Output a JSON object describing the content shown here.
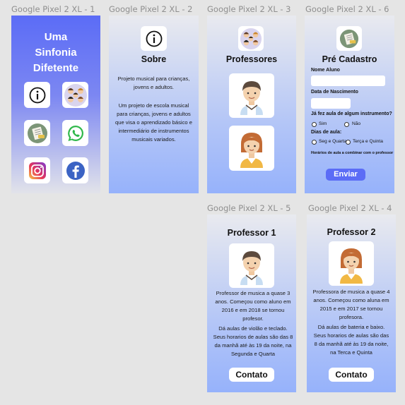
{
  "artboards": {
    "a1": "Google Pixel 2 XL - 1",
    "a2": "Google Pixel 2 XL - 2",
    "a3": "Google Pixel 2 XL - 3",
    "a6": "Google Pixel 2 XL - 6",
    "a5": "Google Pixel 2 XL - 5",
    "a4": "Google Pixel 2 XL - 4"
  },
  "home": {
    "title_line1": "Uma",
    "title_line2": "Sinfonia",
    "title_line3": "Difetente",
    "icons": [
      "info-icon",
      "teachers-group-icon",
      "pre-register-icon",
      "whatsapp-icon",
      "instagram-icon",
      "facebook-icon"
    ]
  },
  "sobre": {
    "title": "Sobre",
    "p1": "Projeto musical para crianças, jovens e adultos.",
    "p2": "Um projeto de escola musical para crianças, jovens e adultos que visa o aprendizado básico e intermediário de instrumentos musicais variados."
  },
  "professores": {
    "title": "Professores"
  },
  "cadastro": {
    "title": "Pré Cadastro",
    "nome_label": "Nome Aluno",
    "nasc_label": "Data de Nascimento",
    "question": "Já fez aula de algum instrumento?",
    "sim": "Sim",
    "nao": "Não",
    "dias_label": "Dias de aula:",
    "dia1": "Seg e Quarta",
    "dia2": "Terça e Quinta",
    "note": "Horários de aula a combinar com o professor",
    "submit": "Enviar"
  },
  "prof1": {
    "title": "Professor 1",
    "p1": "Professor de musica a quase 3 anos. Começou como aluno em 2016 e em 2018 se tornou profesor.",
    "p2": "Dá aulas de violão e teclado. Seus horarios de aulas são das 8 da manhã até às 19 da noite, na Segunda e Quarta",
    "button": "Contato"
  },
  "prof2": {
    "title": "Professor 2",
    "p1": "Professora de musica a quase 4 anos. Começou como aluna em 2015 e em 2017 se tornou profesora.",
    "p2": "Dá aulas de bateria e baixo. Seus horarios de aulas são das 8 da manhã até às 19 da noite, na Terca e Quinta",
    "button": "Contato"
  },
  "colors": {
    "home_gradient_top": "#5b6cf6",
    "screen_gradient_bottom": "#96b2fb",
    "submit_button": "#5b6cf6"
  }
}
